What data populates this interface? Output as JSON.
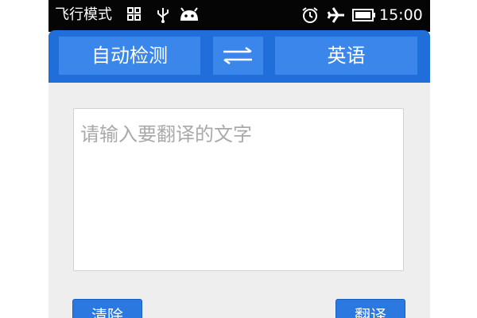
{
  "status_bar": {
    "left_text": "飞行模式",
    "time": "15:00",
    "icons": [
      "grid-icon",
      "usb-icon",
      "android-icon",
      "alarm-icon",
      "airplane-icon",
      "battery-icon"
    ]
  },
  "action_bar": {
    "source_lang": "自动检测",
    "swap_icon": "swap-arrows-icon",
    "target_lang": "英语"
  },
  "input": {
    "value": "",
    "placeholder": "请输入要翻译的文字"
  },
  "buttons": {
    "clear_label": "清除",
    "translate_label": "翻译"
  },
  "colors": {
    "action_bar": "#1f6ed9",
    "action_button": "#3b86ea",
    "primary_button": "#2a78e0",
    "background": "#eeeeee",
    "status_bar": "#050505"
  }
}
